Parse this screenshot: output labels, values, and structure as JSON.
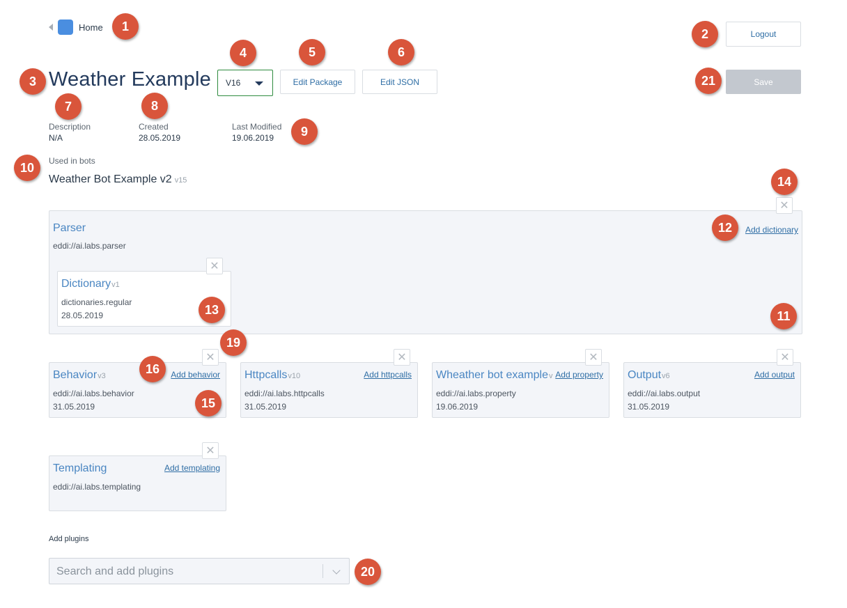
{
  "header": {
    "home_label": "Home",
    "logout_label": "Logout",
    "save_label": "Save"
  },
  "package": {
    "title": "Weather Example",
    "version": "V16",
    "edit_package_label": "Edit Package",
    "edit_json_label": "Edit JSON",
    "description_label": "Description",
    "description_value": "N/A",
    "created_label": "Created",
    "created_value": "28.05.2019",
    "modified_label": "Last Modified",
    "modified_value": "19.06.2019",
    "used_in_label": "Used in bots",
    "bot_name": "Weather Bot Example v2",
    "bot_version": "v15"
  },
  "parser": {
    "title": "Parser",
    "uri": "eddi://ai.labs.parser",
    "add_label": "Add dictionary",
    "dictionary": {
      "title": "Dictionary",
      "version": "v1",
      "uri": "dictionaries.regular",
      "date": "28.05.2019"
    }
  },
  "extensions": [
    {
      "title": "Behavior",
      "version": "v3",
      "uri": "eddi://ai.labs.behavior",
      "date": "31.05.2019",
      "add_label": "Add behavior"
    },
    {
      "title": "Httpcalls",
      "version": "v10",
      "uri": "eddi://ai.labs.httpcalls",
      "date": "31.05.2019",
      "add_label": "Add httpcalls"
    },
    {
      "title": "Wheather bot example",
      "version": "v",
      "uri": "eddi://ai.labs.property",
      "date": "19.06.2019",
      "add_label": "Add property"
    },
    {
      "title": "Output",
      "version": "v6",
      "uri": "eddi://ai.labs.output",
      "date": "31.05.2019",
      "add_label": "Add output"
    },
    {
      "title": "Templating",
      "version": "",
      "uri": "eddi://ai.labs.templating",
      "date": "",
      "add_label": "Add templating"
    }
  ],
  "plugins": {
    "label": "Add plugins",
    "placeholder": "Search and add plugins"
  },
  "icons": {
    "close": "close-icon",
    "caret": "caret-down-icon",
    "chevron": "chevron-down-icon",
    "back": "back-arrow-icon",
    "home": "home-square-icon"
  },
  "colors": {
    "accent": "#2f6ea5",
    "card_title": "#4a86c2",
    "badge": "#d9553b",
    "version_border": "#2e8b3e",
    "save_disabled": "#c3c8cf"
  },
  "badges": [
    "1",
    "2",
    "3",
    "4",
    "5",
    "6",
    "7",
    "8",
    "9",
    "10",
    "11",
    "12",
    "13",
    "14",
    "15",
    "16",
    "19",
    "20",
    "21"
  ]
}
